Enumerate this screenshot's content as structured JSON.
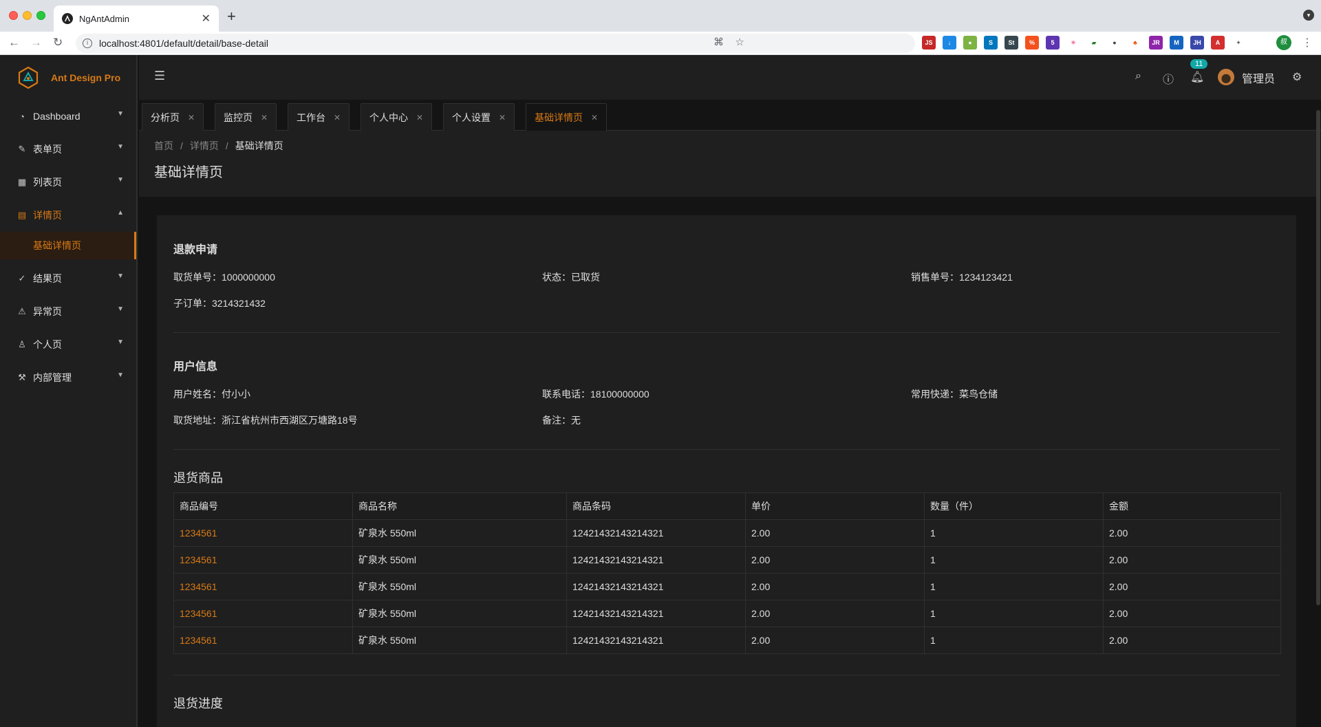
{
  "browser": {
    "tab_title": "NgAntAdmin",
    "url": "localhost:4801/default/detail/base-detail",
    "profile_initial": "叔"
  },
  "app": {
    "logo_text": "Ant Design Pro",
    "accent_color": "#d87a16",
    "sidebar": {
      "items": [
        {
          "label": "Dashboard",
          "icon": "dashboard-icon"
        },
        {
          "label": "表单页",
          "icon": "form-icon"
        },
        {
          "label": "列表页",
          "icon": "table-icon"
        },
        {
          "label": "详情页",
          "icon": "profile-icon"
        },
        {
          "label": "结果页",
          "icon": "check-circle-icon"
        },
        {
          "label": "异常页",
          "icon": "warning-icon"
        },
        {
          "label": "个人页",
          "icon": "user-icon"
        },
        {
          "label": "内部管理",
          "icon": "tool-icon"
        }
      ],
      "sub_item": "基础详情页"
    },
    "header": {
      "notification_count": "11",
      "username": "管理员"
    },
    "tabs": [
      "分析页",
      "监控页",
      "工作台",
      "个人中心",
      "个人设置",
      "基础详情页"
    ],
    "breadcrumb": [
      "首页",
      "详情页",
      "基础详情页"
    ],
    "page_title": "基础详情页",
    "refund": {
      "title": "退款申请",
      "pickup_no": "取货单号：1000000000",
      "status": "状态：已取货",
      "sales_no": "销售单号：1234123421",
      "sub_order": "子订单：3214321432"
    },
    "user": {
      "title": "用户信息",
      "name": "用户姓名：付小小",
      "phone": "联系电话：18100000000",
      "express": "常用快递：菜鸟仓储",
      "address": "取货地址：浙江省杭州市西湖区万塘路18号",
      "remark": "备注：无"
    },
    "goods": {
      "title": "退货商品",
      "columns": [
        "商品编号",
        "商品名称",
        "商品条码",
        "单价",
        "数量（件）",
        "金额"
      ],
      "rows": [
        [
          "1234561",
          "矿泉水 550ml",
          "12421432143214321",
          "2.00",
          "1",
          "2.00"
        ],
        [
          "1234561",
          "矿泉水 550ml",
          "12421432143214321",
          "2.00",
          "1",
          "2.00"
        ],
        [
          "1234561",
          "矿泉水 550ml",
          "12421432143214321",
          "2.00",
          "1",
          "2.00"
        ],
        [
          "1234561",
          "矿泉水 550ml",
          "12421432143214321",
          "2.00",
          "1",
          "2.00"
        ],
        [
          "1234561",
          "矿泉水 550ml",
          "12421432143214321",
          "2.00",
          "1",
          "2.00"
        ]
      ]
    },
    "progress_title": "退货进度"
  }
}
